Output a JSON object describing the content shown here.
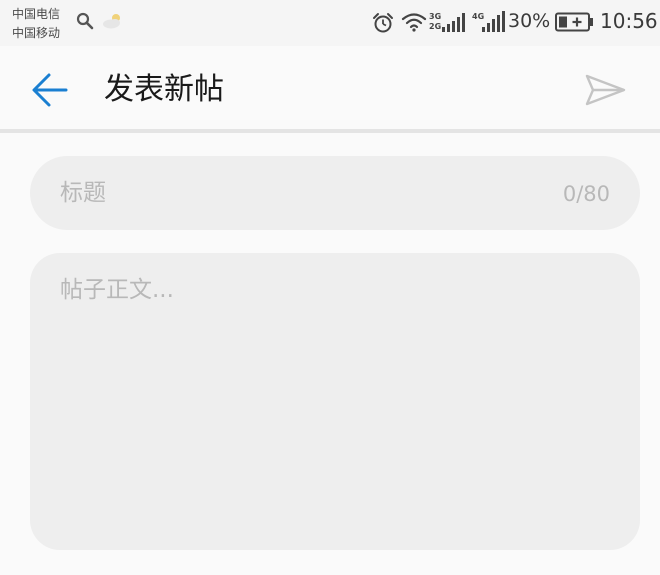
{
  "status_bar": {
    "carrier_1": "中国电信",
    "carrier_2": "中国移动",
    "network_3g": "3G",
    "network_2g": "2G",
    "network_4g": "4G",
    "battery_percent": "30%",
    "time": "10:56",
    "icons": [
      "search-icon",
      "weather-icon",
      "alarm-icon",
      "wifi-icon",
      "signal-icon",
      "battery-icon"
    ]
  },
  "toolbar": {
    "title": "发表新帖",
    "back_icon": "arrow-left-icon",
    "send_icon": "send-icon",
    "accent_color": "#1a7fd1"
  },
  "form": {
    "title_field": {
      "value": "",
      "placeholder": "标题",
      "counter": "0/80"
    },
    "body_field": {
      "value": "",
      "placeholder": "帖子正文..."
    }
  }
}
